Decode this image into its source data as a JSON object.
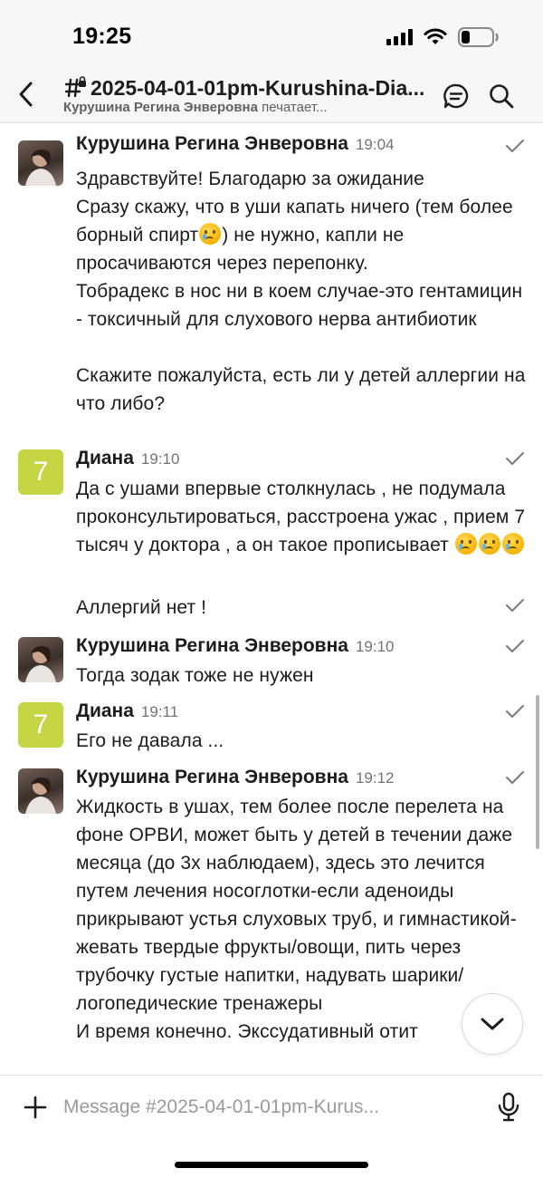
{
  "status_bar": {
    "time": "19:25"
  },
  "header": {
    "channel_title": "2025-04-01-01pm-Kurushina-Dia...",
    "typing_user": "Курушина Регина Энверовна",
    "typing_suffix": " печатает..."
  },
  "messages": [
    {
      "sender": "Курушина Регина Энверовна",
      "time": "19:04",
      "avatar": "photo",
      "body_1": "Здравствуйте! Благодарю за ожидание\nСразу скажу, что в уши капать ничего (тем более борный спирт",
      "emoji_1": "crying-face",
      "body_2": ") не нужно, капли не просачиваются через перепонку.\nТобрадекс в нос ни в коем случае-это гентамицин - токсичный для слухового нерва антибиотик\n\nСкажите пожалуйста, есть ли у детей аллергии на что либо?"
    },
    {
      "sender": "Диана",
      "time": "19:10",
      "avatar": "initial",
      "avatar_initial": "7",
      "body_1": "Да с ушами впервые столкнулась , не подумала проконсультироваться, расстроена ужас , прием 7 тысяч у доктора , а он такое прописывает ",
      "emojis": [
        "crying-face",
        "crying-face",
        "crying-face"
      ],
      "body_2": "Аллергий нет !"
    },
    {
      "sender": "Курушина Регина Энверовна",
      "time": "19:10",
      "avatar": "photo",
      "body_1": "Тогда зодак тоже не нужен"
    },
    {
      "sender": "Диана",
      "time": "19:11",
      "avatar": "initial",
      "avatar_initial": "7",
      "body_1": "Его не давала ..."
    },
    {
      "sender": "Курушина Регина Энверовна",
      "time": "19:12",
      "avatar": "photo",
      "body_1": "Жидкость в ушах, тем более после перелета на фоне ОРВИ, может быть у детей в течении даже месяца (до 3х наблюдаем), здесь это лечится путем лечения носоглотки-если аденоиды прикрывают устья слуховых труб, и гимнастикой-жевать твердые фрукты/овощи, пить через трубочку густые напитки, надувать шарики/логопедические тренажеры\nИ время конечно. Экссудативный отит"
    }
  ],
  "composer": {
    "placeholder": "Message #2025-04-01-01pm-Kurus..."
  },
  "icons": {
    "back": "chevron-left-icon",
    "channel": "hash-lock-icon",
    "threads": "threads-icon",
    "search": "search-icon",
    "sent": "checkmark-icon",
    "jump": "chevron-down-icon",
    "attach": "plus-icon",
    "voice": "microphone-icon"
  },
  "colors": {
    "header_bg": "#f7f7f7",
    "initial_avatar_bg": "#c5d544",
    "text_primary": "#1d1c1d",
    "text_secondary": "#616061"
  }
}
